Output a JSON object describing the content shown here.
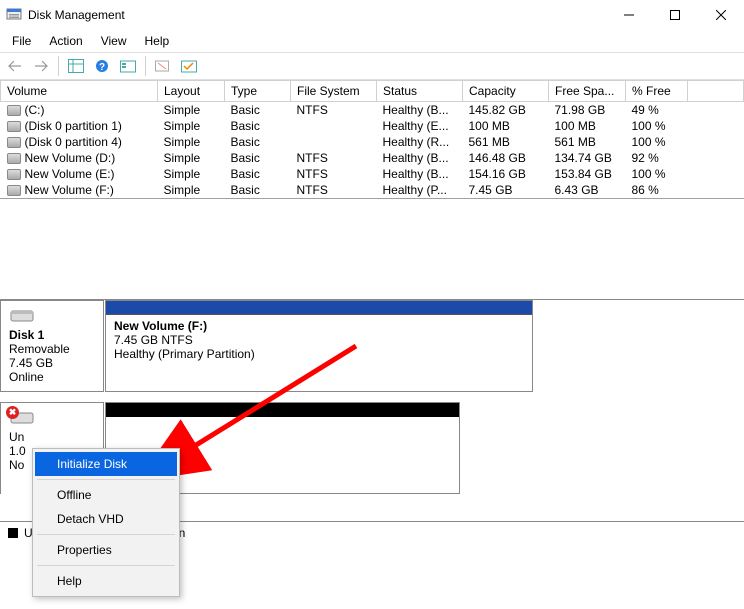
{
  "window": {
    "title": "Disk Management"
  },
  "menu": {
    "file": "File",
    "action": "Action",
    "view": "View",
    "help": "Help"
  },
  "columns": {
    "volume": "Volume",
    "layout": "Layout",
    "type": "Type",
    "fs": "File System",
    "status": "Status",
    "capacity": "Capacity",
    "free": "Free Spa...",
    "pctfree": "% Free"
  },
  "volumes": [
    {
      "name": "(C:)",
      "layout": "Simple",
      "type": "Basic",
      "fs": "NTFS",
      "status": "Healthy (B...",
      "capacity": "145.82 GB",
      "free": "71.98 GB",
      "pct": "49 %"
    },
    {
      "name": "(Disk 0 partition 1)",
      "layout": "Simple",
      "type": "Basic",
      "fs": "",
      "status": "Healthy (E...",
      "capacity": "100 MB",
      "free": "100 MB",
      "pct": "100 %"
    },
    {
      "name": "(Disk 0 partition 4)",
      "layout": "Simple",
      "type": "Basic",
      "fs": "",
      "status": "Healthy (R...",
      "capacity": "561 MB",
      "free": "561 MB",
      "pct": "100 %"
    },
    {
      "name": "New Volume (D:)",
      "layout": "Simple",
      "type": "Basic",
      "fs": "NTFS",
      "status": "Healthy (B...",
      "capacity": "146.48 GB",
      "free": "134.74 GB",
      "pct": "92 %"
    },
    {
      "name": "New Volume (E:)",
      "layout": "Simple",
      "type": "Basic",
      "fs": "NTFS",
      "status": "Healthy (B...",
      "capacity": "154.16 GB",
      "free": "153.84 GB",
      "pct": "100 %"
    },
    {
      "name": "New Volume (F:)",
      "layout": "Simple",
      "type": "Basic",
      "fs": "NTFS",
      "status": "Healthy (P...",
      "capacity": "7.45 GB",
      "free": "6.43 GB",
      "pct": "86 %"
    }
  ],
  "disk1": {
    "name": "Disk 1",
    "removable": "Removable",
    "size": "7.45 GB",
    "state": "Online",
    "part_name": "New Volume  (F:)",
    "part_size": "7.45 GB NTFS",
    "part_status": "Healthy (Primary Partition)"
  },
  "disk2": {
    "un": "Un",
    "v": "1.0",
    "no": "No"
  },
  "context": {
    "initialize": "Initialize Disk",
    "offline": "Offline",
    "detach": "Detach VHD",
    "properties": "Properties",
    "help": "Help"
  },
  "legend": {
    "u": "U",
    "n": "n"
  }
}
